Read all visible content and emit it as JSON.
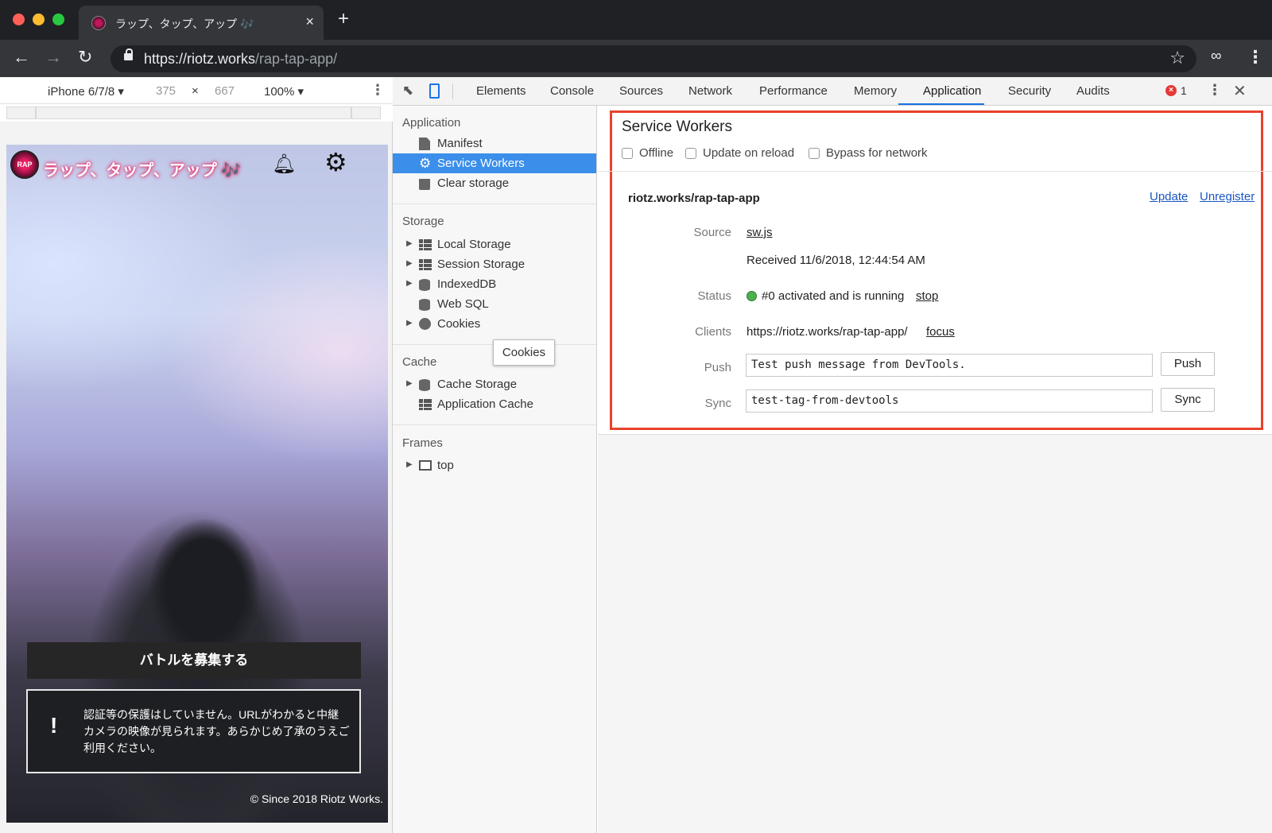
{
  "browser": {
    "tab_title": "ラップ、タップ、アップ 🎶",
    "tab_close": "×",
    "new_tab": "+",
    "url_host": "https://riotz.works",
    "url_path": "/rap-tap-app/",
    "star": "☆",
    "incognito": "👓",
    "menu": "⋮",
    "back": "←",
    "forward": "→",
    "reload": "↻"
  },
  "device_toolbar": {
    "device": "iPhone 6/7/8 ▾",
    "width": "375",
    "times": "×",
    "height": "667",
    "zoom": "100% ▾",
    "more": "⋮"
  },
  "app": {
    "logo_text": "RAP",
    "title": "ラップ、タップ、アップ 🎶",
    "bell": "🔔",
    "gear": "⚙",
    "battle_button": "バトルを募集する",
    "notice_mark": "!",
    "notice_text": "認証等の保護はしていません。URLがわかると中継カメラの映像が見られます。あらかじめ了承のうえご利用ください。",
    "copyright": "© Since 2018 Riotz Works."
  },
  "devtools": {
    "inspect_icon": "⬉",
    "tabs": [
      "Elements",
      "Console",
      "Sources",
      "Network",
      "Performance",
      "Memory",
      "Application",
      "Security",
      "Audits"
    ],
    "active_tab": "Application",
    "error_icon": "×",
    "error_count": "1",
    "more": "⋮",
    "close": "✕",
    "sidebar": {
      "application_header": "Application",
      "manifest": "Manifest",
      "service_workers": "Service Workers",
      "clear_storage": "Clear storage",
      "storage_header": "Storage",
      "local_storage": "Local Storage",
      "session_storage": "Session Storage",
      "indexeddb": "IndexedDB",
      "web_sql": "Web SQL",
      "cookies": "Cookies",
      "cache_header": "Cache",
      "cache_storage": "Cache Storage",
      "application_cache": "Application Cache",
      "frames_header": "Frames",
      "top": "top",
      "gear_glyph": "⚙",
      "expand_glyph": "▶"
    },
    "tooltip": "Cookies",
    "service_workers": {
      "title": "Service Workers",
      "offline": "Offline",
      "update_on_reload": "Update on reload",
      "bypass_for_network": "Bypass for network",
      "scope": "riotz.works/rap-tap-app",
      "update_link": "Update",
      "unregister_link": "Unregister",
      "source_label": "Source",
      "source_value": "sw.js",
      "received": "Received 11/6/2018, 12:44:54 AM",
      "status_label": "Status",
      "status_value": "#0 activated and is running",
      "stop_link": "stop",
      "clients_label": "Clients",
      "clients_value": "https://riotz.works/rap-tap-app/",
      "focus_link": "focus",
      "push_label": "Push",
      "push_value": "Test push message from DevTools.",
      "push_button": "Push",
      "sync_label": "Sync",
      "sync_value": "test-tag-from-devtools",
      "sync_button": "Sync"
    }
  },
  "colors": {
    "highlight": "#e8412c",
    "selection": "#3b8eea",
    "link": "#1a56c2",
    "status_running": "#4caf50"
  }
}
